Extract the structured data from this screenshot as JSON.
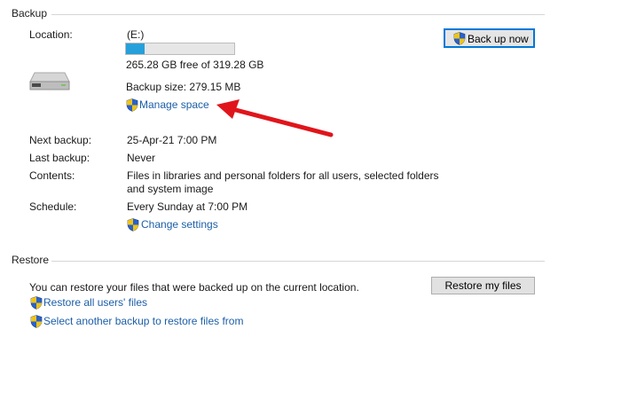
{
  "backup": {
    "title": "Backup",
    "location_label": "Location:",
    "drive": "(E:)",
    "used_fraction": 0.17,
    "free_text": "265.28 GB free of 319.28 GB",
    "backup_size": "Backup size: 279.15 MB",
    "manage_space": "Manage space",
    "back_up_now": "Back up now",
    "next_backup_label": "Next backup:",
    "next_backup": "25-Apr-21 7:00 PM",
    "last_backup_label": "Last backup:",
    "last_backup": "Never",
    "contents_label": "Contents:",
    "contents": "Files in libraries and personal folders for all users, selected folders and system image",
    "schedule_label": "Schedule:",
    "schedule": "Every Sunday at 7:00 PM",
    "change_settings": "Change settings"
  },
  "restore": {
    "title": "Restore",
    "description": "You can restore your files that were backed up on the current location.",
    "restore_my_files": "Restore my files",
    "restore_all_users": "Restore all users' files",
    "select_another": "Select another backup to restore files from"
  },
  "colors": {
    "accent": "#0078d7",
    "link": "#1c5ea8",
    "progress": "#26a0da",
    "annotation_arrow": "#e0151b"
  },
  "icons": [
    "drive-icon",
    "shield-icon",
    "red-arrow-annotation"
  ]
}
